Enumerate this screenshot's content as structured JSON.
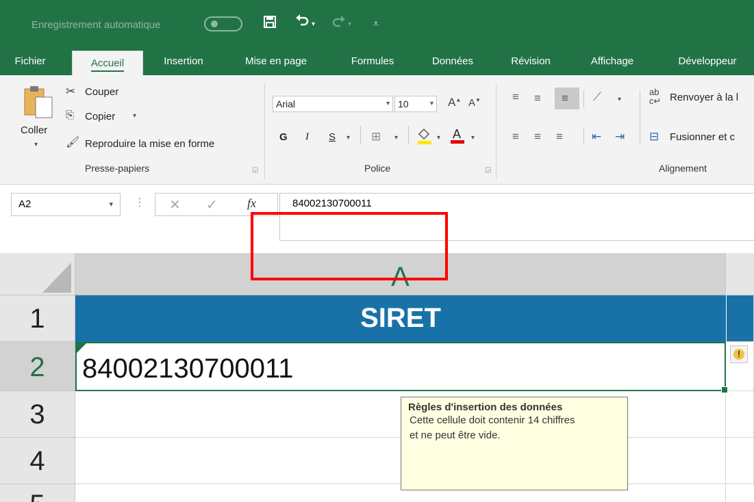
{
  "titlebar": {
    "autosave_label": "Enregistrement automatique",
    "save_icon": "save-icon",
    "undo_icon": "undo-icon",
    "redo_icon": "redo-icon",
    "customize_icon": "customize-qat-icon"
  },
  "tabs": [
    {
      "label": "Fichier"
    },
    {
      "label": "Accueil"
    },
    {
      "label": "Insertion"
    },
    {
      "label": "Mise en page"
    },
    {
      "label": "Formules"
    },
    {
      "label": "Données"
    },
    {
      "label": "Révision"
    },
    {
      "label": "Affichage"
    },
    {
      "label": "Développeur"
    }
  ],
  "ribbon": {
    "clipboard": {
      "paste_label": "Coller",
      "cut_label": "Couper",
      "copy_label": "Copier",
      "format_painter_label": "Reproduire la mise en forme",
      "group_label": "Presse-papiers"
    },
    "font": {
      "font_name": "Arial",
      "font_size": "10",
      "bold": "G",
      "italic": "I",
      "underline": "S",
      "group_label": "Police"
    },
    "alignment": {
      "wrap_label": "Renvoyer à la l",
      "merge_label": "Fusionner et c",
      "group_label": "Alignement"
    }
  },
  "formula_bar": {
    "name_box": "A2",
    "fx_label": "fx",
    "formula": "84002130700011"
  },
  "grid": {
    "column_a": "A",
    "rows": [
      "1",
      "2",
      "3",
      "4",
      "5"
    ],
    "a1": "SIRET",
    "a2": "84002130700011"
  },
  "tooltip": {
    "title": "Règles d'insertion des données",
    "line1": "Cette cellule doit contenir 14 chiffres",
    "line2": "et ne peut être vide."
  },
  "colors": {
    "excel_green": "#217346",
    "header_blue": "#1872a8",
    "highlight_red": "#ff0000",
    "tooltip_bg": "#ffffe1"
  }
}
